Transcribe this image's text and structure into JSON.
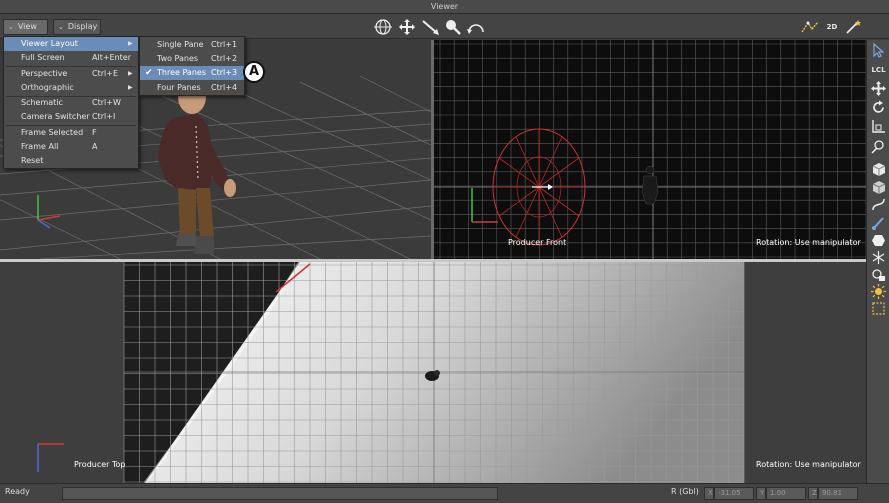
{
  "window": {
    "title": "Viewer"
  },
  "toolbar": {
    "view_menu": "View",
    "display_menu": "Display",
    "tools": [
      "orbit-icon",
      "pan-icon",
      "dolly-icon",
      "zoom-icon",
      "roll-icon"
    ],
    "right_tools": [
      "path-icon",
      "2d-icon",
      "magic-icon"
    ],
    "label_2d": "2D"
  },
  "view_menu": {
    "items": [
      {
        "label": "Viewer Layout",
        "shortcut": "",
        "submenu": true,
        "highlighted": true
      },
      {
        "label": "Full Screen",
        "shortcut": "Alt+Enter"
      },
      {
        "label": "Perspective",
        "shortcut": "Ctrl+E",
        "submenu": true
      },
      {
        "label": "Orthographic",
        "shortcut": "",
        "submenu": true
      },
      {
        "label": "Schematic",
        "shortcut": "Ctrl+W"
      },
      {
        "label": "Camera Switcher",
        "shortcut": "Ctrl+I"
      },
      {
        "label": "Frame Selected",
        "shortcut": "F"
      },
      {
        "label": "Frame All",
        "shortcut": "A"
      },
      {
        "label": "Reset",
        "shortcut": ""
      }
    ]
  },
  "layout_submenu": {
    "items": [
      {
        "label": "Single Pane",
        "shortcut": "Ctrl+1",
        "checked": false
      },
      {
        "label": "Two Panes",
        "shortcut": "Ctrl+2",
        "checked": false
      },
      {
        "label": "Three Panes",
        "shortcut": "Ctrl+3",
        "checked": true
      },
      {
        "label": "Four Panes",
        "shortcut": "Ctrl+4",
        "checked": false
      }
    ]
  },
  "callout": "A",
  "panes": {
    "front": {
      "label": "Producer Front",
      "rotation": "Rotation: Use manipulator"
    },
    "top": {
      "label": "Producer Top",
      "rotation": "Rotation: Use manipulator"
    }
  },
  "side_tools": [
    "select-icon",
    "local-icon",
    "translate-icon",
    "rotate-icon",
    "scale-icon",
    "transform-icon",
    "object-mode-icon",
    "component-mode-icon",
    "curve-icon",
    "brush-icon",
    "hexagon-icon",
    "skeleton-icon",
    "lock-icon",
    "light-icon",
    "bounding-box-icon"
  ],
  "side_labels": {
    "local": "LCL"
  },
  "statusbar": {
    "status": "Ready",
    "rotation_mode": "R (Gbl)",
    "x_label": "X",
    "x_value": "-31.05",
    "y_label": "Y",
    "y_value": "1.00",
    "z_label": "Z",
    "z_value": "90.81"
  }
}
